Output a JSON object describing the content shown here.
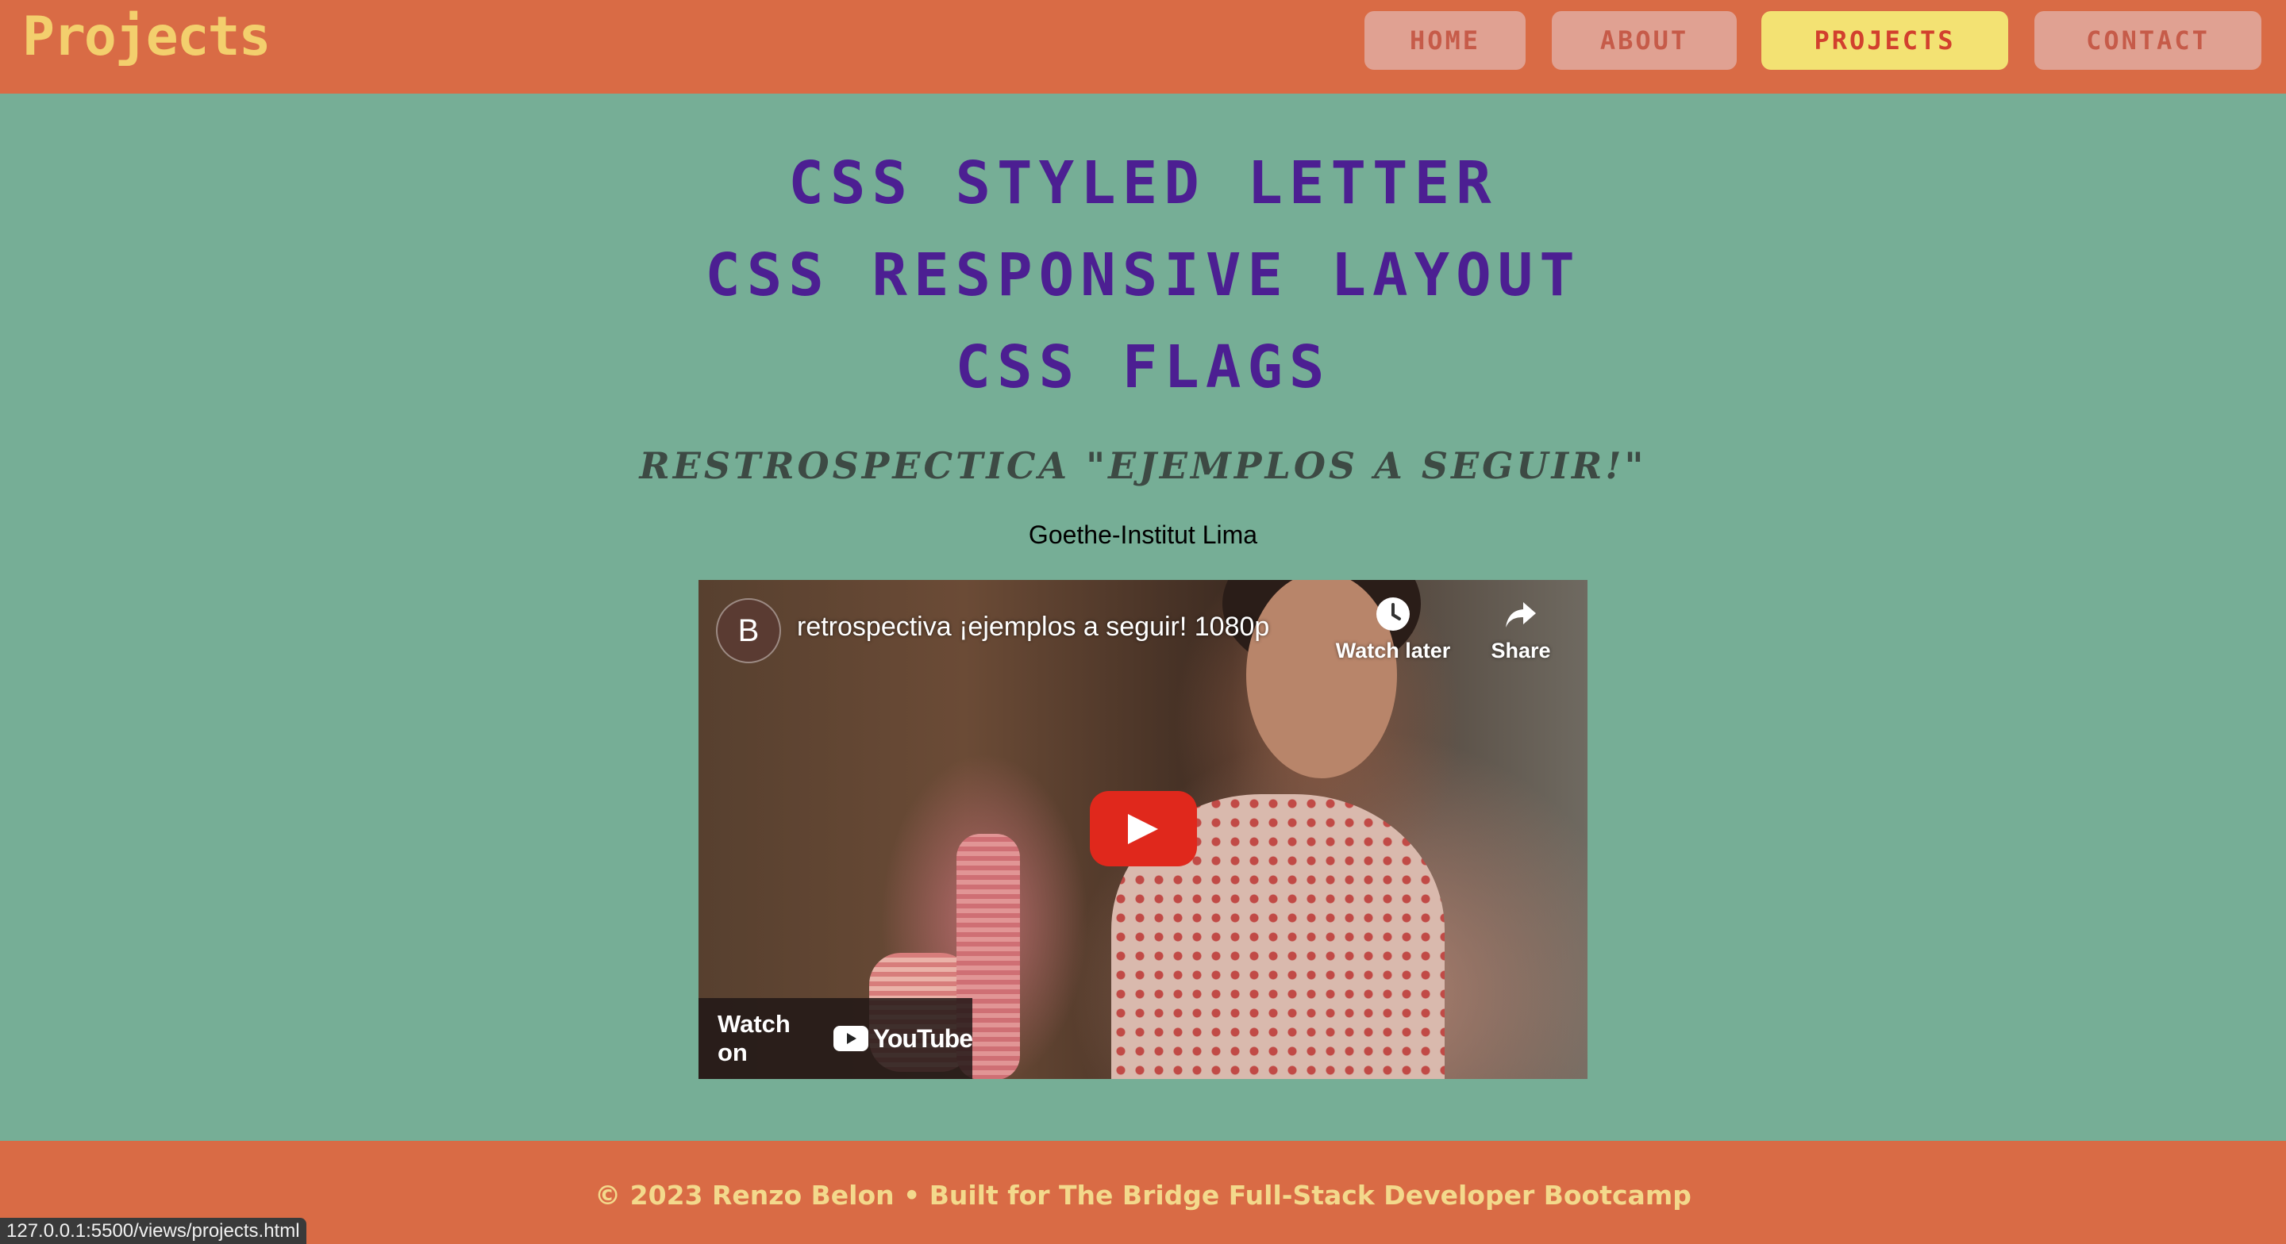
{
  "header": {
    "brand": "Projects",
    "nav": [
      {
        "label": "HOME",
        "active": false
      },
      {
        "label": "ABOUT",
        "active": false
      },
      {
        "label": "PROJECTS",
        "active": true
      },
      {
        "label": "CONTACT",
        "active": false
      }
    ]
  },
  "main": {
    "projects": [
      {
        "label": "CSS STYLED LETTER"
      },
      {
        "label": "CSS RESPONSIVE LAYOUT"
      },
      {
        "label": "CSS FLAGS"
      }
    ],
    "subtitle": "RESTROSPECTICA \"EJEMPLOS A SEGUIR!\"",
    "institute": "Goethe-Institut Lima",
    "video": {
      "channel_initial": "B",
      "title": "retrospectiva ¡ejemplos a seguir! 1080p",
      "watch_later_label": "Watch later",
      "share_label": "Share",
      "watch_on_label": "Watch on",
      "youtube_label": "YouTube",
      "play_icon": "play-icon"
    }
  },
  "footer": {
    "text": "© 2023 Renzo Belon • Built for The Bridge Full-Stack Developer Bootcamp"
  },
  "status_bar": {
    "url": "127.0.0.1:5500/views/projects.html"
  },
  "colors": {
    "header_bg": "#d96b45",
    "page_bg": "#76ae96",
    "brand": "#f3cf6d",
    "nav_bg": "#e0a192",
    "nav_active_bg": "#f3e273",
    "project_link": "#4c1f92",
    "play_button": "#e0281c"
  }
}
